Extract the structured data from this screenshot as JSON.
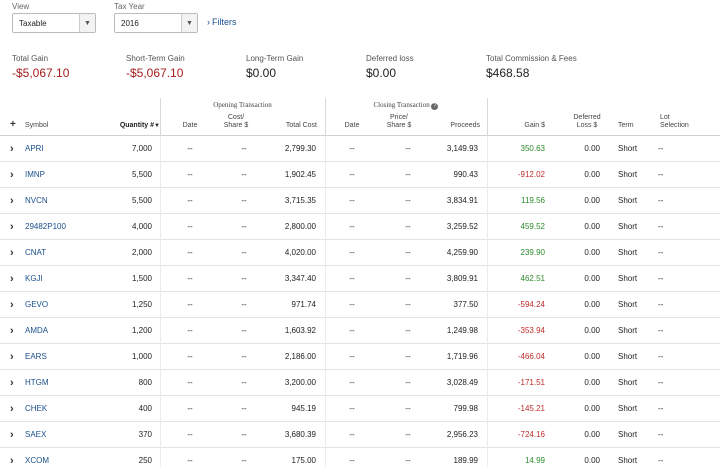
{
  "filters": {
    "view_label": "View",
    "view_value": "Taxable",
    "year_label": "Tax Year",
    "year_value": "2016",
    "filters_link": "Filters",
    "arrow_icon": "triangle-down"
  },
  "summary": [
    {
      "label": "Total Gain",
      "value": "-$5,067.10",
      "negative": true
    },
    {
      "label": "Short-Term Gain",
      "value": "-$5,067.10",
      "negative": true
    },
    {
      "label": "Long-Term Gain",
      "value": "$0.00",
      "negative": false
    },
    {
      "label": "Deferred loss",
      "value": "$0.00",
      "negative": false
    },
    {
      "label": "Total Commission & Fees",
      "value": "$468.58",
      "negative": false
    }
  ],
  "header": {
    "opening_group": "Opening Transaction",
    "closing_group": "Closing Transaction",
    "add_icon": "+",
    "columns": {
      "symbol": "Symbol",
      "quantity": "Quantity #",
      "open_date": "Date",
      "open_cost_share_1": "Cost/",
      "open_cost_share_2": "Share $",
      "total_cost": "Total Cost",
      "close_date": "Date",
      "close_price_1": "Price/",
      "close_price_2": "Share $",
      "proceeds": "Proceeds",
      "gain": "Gain $",
      "deferred_1": "Deferred",
      "deferred_2": "Loss $",
      "term": "Term",
      "lot_1": "Lot",
      "lot_2": "Selection"
    }
  },
  "colors": {
    "positive": "#2c8a2c",
    "negative": "#c02b2b",
    "link": "#1a4f8b"
  },
  "rows": [
    {
      "symbol": "APRI",
      "quantity": "7,000",
      "open_date": "--",
      "cost_share": "--",
      "total_cost": "2,799.30",
      "close_date": "--",
      "price_share": "--",
      "proceeds": "3,149.93",
      "gain": "350.63",
      "gain_positive": true,
      "deferred": "0.00",
      "term": "Short",
      "lot": "--"
    },
    {
      "symbol": "IMNP",
      "quantity": "5,500",
      "open_date": "--",
      "cost_share": "--",
      "total_cost": "1,902.45",
      "close_date": "--",
      "price_share": "--",
      "proceeds": "990.43",
      "gain": "-912.02",
      "gain_positive": false,
      "deferred": "0.00",
      "term": "Short",
      "lot": "--"
    },
    {
      "symbol": "NVCN",
      "quantity": "5,500",
      "open_date": "--",
      "cost_share": "--",
      "total_cost": "3,715.35",
      "close_date": "--",
      "price_share": "--",
      "proceeds": "3,834.91",
      "gain": "119.56",
      "gain_positive": true,
      "deferred": "0.00",
      "term": "Short",
      "lot": "--"
    },
    {
      "symbol": "29482P100",
      "quantity": "4,000",
      "open_date": "--",
      "cost_share": "--",
      "total_cost": "2,800.00",
      "close_date": "--",
      "price_share": "--",
      "proceeds": "3,259.52",
      "gain": "459.52",
      "gain_positive": true,
      "deferred": "0.00",
      "term": "Short",
      "lot": "--"
    },
    {
      "symbol": "CNAT",
      "quantity": "2,000",
      "open_date": "--",
      "cost_share": "--",
      "total_cost": "4,020.00",
      "close_date": "--",
      "price_share": "--",
      "proceeds": "4,259.90",
      "gain": "239.90",
      "gain_positive": true,
      "deferred": "0.00",
      "term": "Short",
      "lot": "--"
    },
    {
      "symbol": "KGJI",
      "quantity": "1,500",
      "open_date": "--",
      "cost_share": "--",
      "total_cost": "3,347.40",
      "close_date": "--",
      "price_share": "--",
      "proceeds": "3,809.91",
      "gain": "462.51",
      "gain_positive": true,
      "deferred": "0.00",
      "term": "Short",
      "lot": "--"
    },
    {
      "symbol": "GEVO",
      "quantity": "1,250",
      "open_date": "--",
      "cost_share": "--",
      "total_cost": "971.74",
      "close_date": "--",
      "price_share": "--",
      "proceeds": "377.50",
      "gain": "-594.24",
      "gain_positive": false,
      "deferred": "0.00",
      "term": "Short",
      "lot": "--"
    },
    {
      "symbol": "AMDA",
      "quantity": "1,200",
      "open_date": "--",
      "cost_share": "--",
      "total_cost": "1,603.92",
      "close_date": "--",
      "price_share": "--",
      "proceeds": "1,249.98",
      "gain": "-353.94",
      "gain_positive": false,
      "deferred": "0.00",
      "term": "Short",
      "lot": "--"
    },
    {
      "symbol": "EARS",
      "quantity": "1,000",
      "open_date": "--",
      "cost_share": "--",
      "total_cost": "2,186.00",
      "close_date": "--",
      "price_share": "--",
      "proceeds": "1,719.96",
      "gain": "-466.04",
      "gain_positive": false,
      "deferred": "0.00",
      "term": "Short",
      "lot": "--"
    },
    {
      "symbol": "HTGM",
      "quantity": "800",
      "open_date": "--",
      "cost_share": "--",
      "total_cost": "3,200.00",
      "close_date": "--",
      "price_share": "--",
      "proceeds": "3,028.49",
      "gain": "-171.51",
      "gain_positive": false,
      "deferred": "0.00",
      "term": "Short",
      "lot": "--"
    },
    {
      "symbol": "CHEK",
      "quantity": "400",
      "open_date": "--",
      "cost_share": "--",
      "total_cost": "945.19",
      "close_date": "--",
      "price_share": "--",
      "proceeds": "799.98",
      "gain": "-145.21",
      "gain_positive": false,
      "deferred": "0.00",
      "term": "Short",
      "lot": "--"
    },
    {
      "symbol": "SAEX",
      "quantity": "370",
      "open_date": "--",
      "cost_share": "--",
      "total_cost": "3,680.39",
      "close_date": "--",
      "price_share": "--",
      "proceeds": "2,956.23",
      "gain": "-724.16",
      "gain_positive": false,
      "deferred": "0.00",
      "term": "Short",
      "lot": "--"
    },
    {
      "symbol": "XCOM",
      "quantity": "250",
      "open_date": "--",
      "cost_share": "--",
      "total_cost": "175.00",
      "close_date": "--",
      "price_share": "--",
      "proceeds": "189.99",
      "gain": "14.99",
      "gain_positive": true,
      "deferred": "0.00",
      "term": "Short",
      "lot": "--"
    }
  ]
}
